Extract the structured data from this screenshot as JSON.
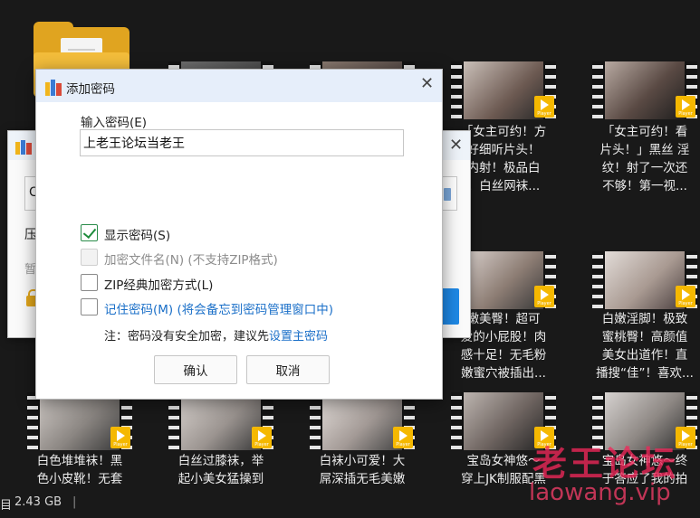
{
  "dialog": {
    "title": "添加密码",
    "close_glyph": "✕",
    "password_label": "输入密码(E)",
    "password_value": "上老王论坛当老王",
    "options": [
      {
        "label": "显示密码(S)",
        "checked": true,
        "state": "normal"
      },
      {
        "label": "加密文件名(N) (不支持ZIP格式)",
        "checked": false,
        "state": "disabled"
      },
      {
        "label": "ZIP经典加密方式(L)",
        "checked": false,
        "state": "normal"
      },
      {
        "label": "记住密码(M) (将会备忘到密码管理窗口中)",
        "checked": false,
        "state": "link"
      }
    ],
    "note_prefix": "注：密码没有安全加密，建议先",
    "note_link": "设置主密码",
    "ok_label": "确认",
    "cancel_label": "取消"
  },
  "background_dialog": {
    "close_glyph": "✕",
    "field_text": "C",
    "row1_text": "压",
    "row2_text": "暂"
  },
  "explorer": {
    "captions": {
      "c1": [
        "「女主可约！方",
        "好细听片头！",
        "内射！极品白",
        "！白丝网袜..."
      ],
      "c2": [
        "「女主可约！看",
        "片头！」黑丝 淫",
        "纹！射了一次还",
        "不够！第一视..."
      ],
      "c3": [
        "嫩美臀！超可",
        "爱的小屁股！肉",
        "感十足！无毛粉",
        "嫩蜜穴被插出..."
      ],
      "c4": [
        "白嫩淫脚！极致",
        "蜜桃臀！高颜值",
        "美女出道作！直",
        "播搜“佳”！喜欢..."
      ],
      "c5": [
        "白色堆堆袜！黑",
        "色小皮靴！无套"
      ],
      "c6": [
        "白丝过膝袜，举",
        "起小美女猛操到"
      ],
      "c7": [
        "白袜小可爱！大",
        "屌深插无毛美嫩"
      ],
      "c8": [
        "宝岛女神悠～",
        "穿上JK制服配黑"
      ],
      "c9": [
        "宝岛女神悠～终",
        "于答应了我的拍"
      ]
    },
    "player_badge": "Player",
    "status_items": "目",
    "status_size": "2.43 GB",
    "status_sep": "|"
  },
  "watermark": {
    "cn": "老王论坛",
    "en": "laowang.vip"
  }
}
